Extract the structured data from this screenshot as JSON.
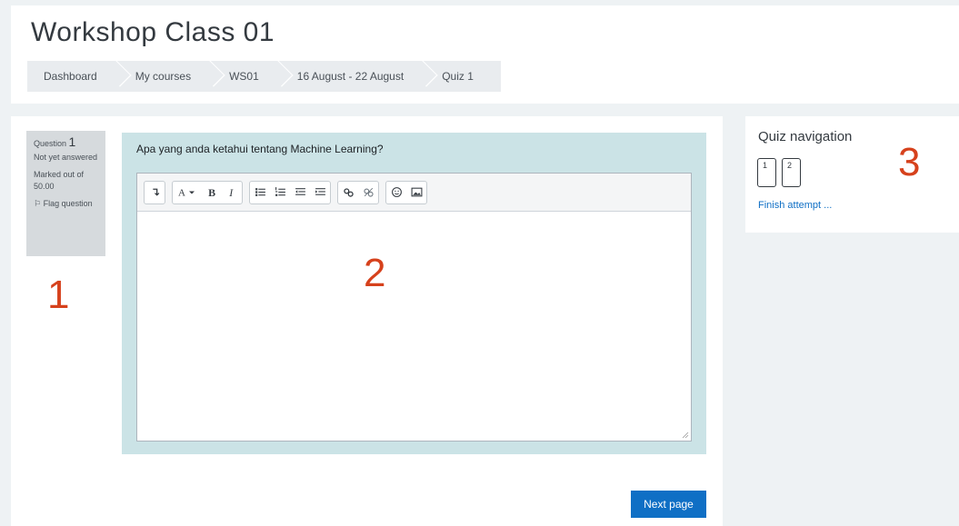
{
  "header": {
    "title": "Workshop Class 01",
    "breadcrumb": [
      "Dashboard",
      "My courses",
      "WS01",
      "16 August - 22 August",
      "Quiz 1"
    ]
  },
  "question": {
    "number_label": "Question",
    "number": "1",
    "state": "Not yet answered",
    "grade": "Marked out of 50.00",
    "flag_label": "Flag question",
    "text": "Apa yang anda ketahui tentang Machine Learning?"
  },
  "editor": {
    "toolbar_groups": [
      [
        "expand-icon"
      ],
      [
        "font-style-icon",
        "bold-icon",
        "italic-icon"
      ],
      [
        "unordered-list-icon",
        "ordered-list-icon",
        "outdent-icon",
        "indent-icon"
      ],
      [
        "link-icon",
        "unlink-icon"
      ],
      [
        "emoji-icon",
        "image-icon"
      ]
    ],
    "value": ""
  },
  "buttons": {
    "next_page": "Next page"
  },
  "quiz_nav": {
    "title": "Quiz navigation",
    "pages": [
      "1",
      "2"
    ],
    "finish_label": "Finish attempt ..."
  },
  "annotations": [
    "1",
    "2",
    "3"
  ],
  "colors": {
    "primary": "#0f6fc5",
    "annotation": "#d6411c",
    "formulation_bg": "#cbe3e6"
  }
}
